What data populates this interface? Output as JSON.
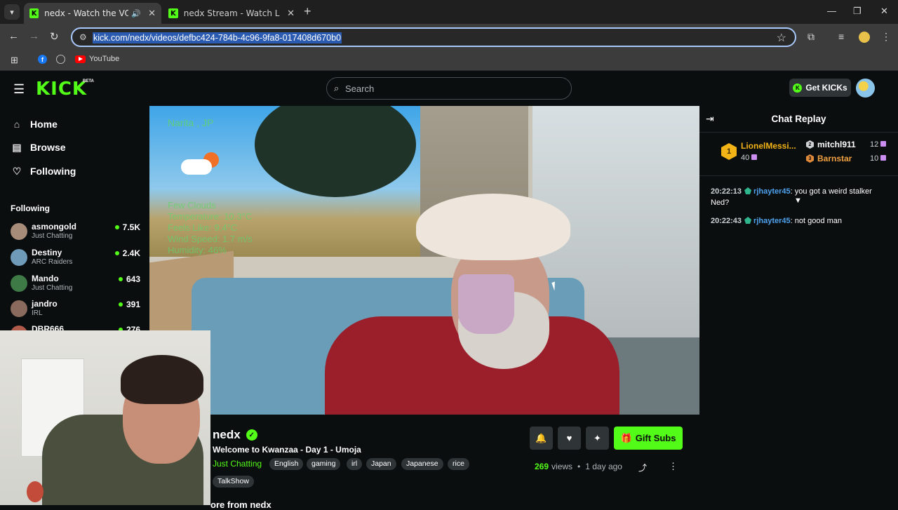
{
  "browser": {
    "tabs": [
      {
        "title": "nedx - Watch the VOD on Kick",
        "favicon": "K"
      },
      {
        "title": "nedx Stream - Watch Live on Kick",
        "favicon": "K"
      }
    ],
    "url": "kick.com/nedx/videos/defbc424-784b-4c96-9fa8-017408d670b0",
    "bookmarks": {
      "facebook": "f",
      "youtube": "YouTube"
    }
  },
  "header": {
    "logo": "KICK",
    "logo_badge": "BETA",
    "search_placeholder": "Search",
    "get_kicks": "Get KICKs"
  },
  "sidebar": {
    "nav": [
      {
        "label": "Home",
        "icon": "home-icon"
      },
      {
        "label": "Browse",
        "icon": "browse-icon"
      },
      {
        "label": "Following",
        "icon": "heart-icon"
      }
    ],
    "following_title": "Following",
    "channels": [
      {
        "name": "asmongold",
        "category": "Just Chatting",
        "viewers": "7.5K",
        "color": "#a88c7a"
      },
      {
        "name": "Destiny",
        "category": "ARC Raiders",
        "viewers": "2.4K",
        "color": "#6f9ab8"
      },
      {
        "name": "Mando",
        "category": "Just Chatting",
        "viewers": "643",
        "color": "#3d7a46"
      },
      {
        "name": "jandro",
        "category": "IRL",
        "viewers": "391",
        "color": "#8a6a5c"
      },
      {
        "name": "DBR666",
        "category": "",
        "viewers": "276",
        "color": "#b05a4a"
      }
    ]
  },
  "video_overlay": {
    "location": "Narita , JP",
    "weather_lines": [
      "Few Clouds",
      "Temperature: 10.3°C",
      "Feels Like: 9.4°C",
      "Wind Speed: 1.7 m/s",
      "Humidity: 46%"
    ]
  },
  "stream_info": {
    "channel": "nedx",
    "title": "Welcome to Kwanzaa - Day 1 - Umoja",
    "category": "Just Chatting",
    "tags": [
      "English",
      "gaming",
      "irl",
      "Japan",
      "Japanese",
      "rice",
      "TalkShow"
    ],
    "views": "269",
    "views_label": "views",
    "age": "1 day ago",
    "gift_subs": "Gift Subs",
    "more_from": "ore from nedx"
  },
  "chat": {
    "title": "Chat Replay",
    "leaderboard": [
      {
        "rank": "1",
        "name": "LionelMessi...",
        "value": "40"
      },
      {
        "rank": "2",
        "name": "mitchl911",
        "value": "12"
      },
      {
        "rank": "3",
        "name": "Barnstar",
        "value": "10"
      }
    ],
    "messages": [
      {
        "time": "20:22:13",
        "user": "rjhayter45",
        "text": ": you got a weird stalker Ned?"
      },
      {
        "time": "20:22:43",
        "user": "rjhayter45",
        "text": ": not good man"
      }
    ]
  },
  "colors": {
    "brand": "#53fc18",
    "background": "#0b0e0f",
    "chat_user": "#4ea3f0",
    "rank_gold": "#f2b316"
  }
}
